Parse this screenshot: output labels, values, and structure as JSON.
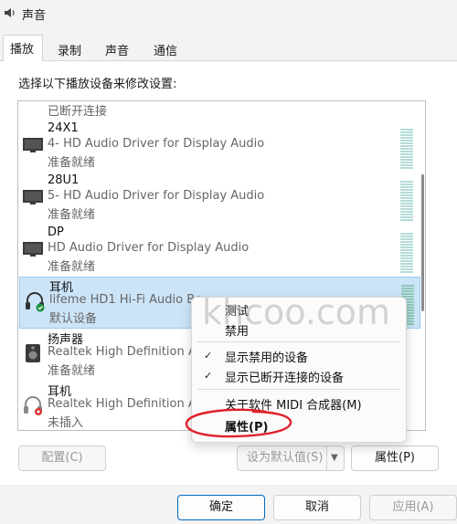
{
  "window": {
    "title": "声音"
  },
  "tabs": [
    {
      "label": "播放",
      "active": true
    },
    {
      "label": "录制",
      "active": false
    },
    {
      "label": "声音",
      "active": false
    },
    {
      "label": "通信",
      "active": false
    }
  ],
  "instruction": "选择以下播放设备来修改设置:",
  "partial_status": "已断开连接",
  "devices": [
    {
      "name": "24X1",
      "driver": "4- HD Audio Driver for Display Audio",
      "status": "准备就绪",
      "icon": "monitor-icon"
    },
    {
      "name": "28U1",
      "driver": "5- HD Audio Driver for Display Audio",
      "status": "准备就绪",
      "icon": "monitor-icon"
    },
    {
      "name": "DP",
      "driver": "HD Audio Driver for Display Audio",
      "status": "准备就绪",
      "icon": "monitor-icon"
    },
    {
      "name": "耳机",
      "driver": "lifeme HD1 Hi-Fi Audio Bo",
      "status": "默认设备",
      "icon": "headphones-default-icon",
      "selected": true
    },
    {
      "name": "扬声器",
      "driver": "Realtek High Definition A",
      "status": "准备就绪",
      "icon": "speaker-icon"
    },
    {
      "name": "耳机",
      "driver": "Realtek High Definition A",
      "status": "未插入",
      "icon": "headphones-unplugged-icon"
    }
  ],
  "context_menu": {
    "items": [
      {
        "label": "测试",
        "checked": false
      },
      {
        "label": "禁用",
        "checked": false
      },
      {
        "label": "显示禁用的设备",
        "checked": true
      },
      {
        "label": "显示已断开连接的设备",
        "checked": true
      },
      {
        "label": "关于软件 MIDI 合成器(M)",
        "checked": false
      },
      {
        "label": "属性(P)",
        "checked": false,
        "bold": true
      }
    ]
  },
  "buttons": {
    "configure": "配置(C)",
    "set_default": "设为默认值(S)",
    "properties": "属性(P)",
    "ok": "确定",
    "cancel": "取消",
    "apply": "应用(A)"
  },
  "watermark": "khcoo.com",
  "colors": {
    "selection": "#cce4f7",
    "accent": "#0067c0",
    "annotation": "#e0202a"
  }
}
